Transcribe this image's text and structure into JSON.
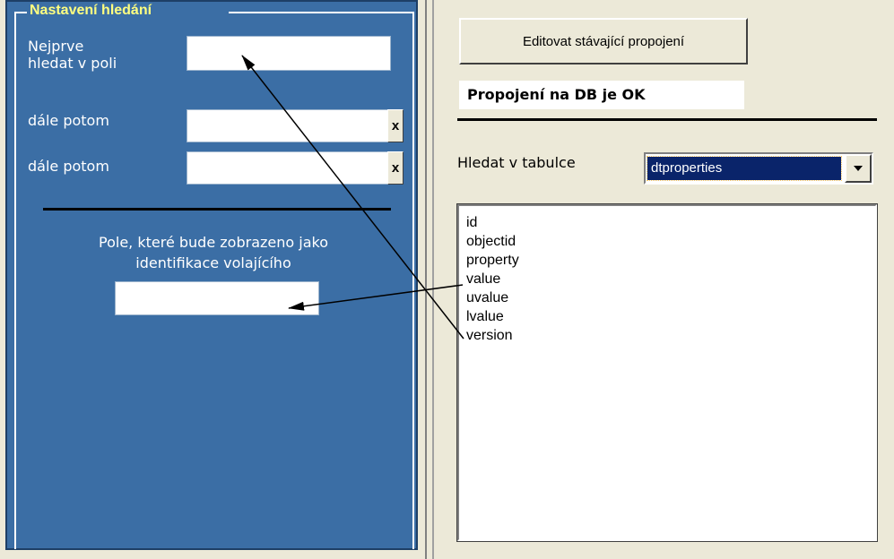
{
  "search_settings": {
    "legend": "Nastavení hledání",
    "first_field_label_line1": "Nejprve",
    "first_field_label_line2": "hledat v poli",
    "then_label_1": "dále potom",
    "then_label_2": "dále potom",
    "clear_symbol": "x",
    "display_field_text_line1": "Pole, které bude zobrazeno jako",
    "display_field_text_line2": "identifikace volajícího",
    "first_field_value": "",
    "then_field_1_value": "",
    "then_field_2_value": "",
    "display_field_value": ""
  },
  "connection": {
    "edit_button_label": "Editovat stávající propojení",
    "status_text": "Propojení na DB je OK"
  },
  "table_select": {
    "label": "Hledat v tabulce",
    "selected": "dtproperties"
  },
  "columns_list": [
    "id",
    "objectid",
    "property",
    "value",
    "uvalue",
    "lvalue",
    "version"
  ],
  "colors": {
    "panel_blue": "#3b6ea5",
    "legend_yellow": "#ffff80",
    "selection_navy": "#0a246a",
    "window_bg": "#ece9d8"
  },
  "icons": {
    "clear": "close-icon",
    "dropdown": "chevron-down-icon"
  }
}
